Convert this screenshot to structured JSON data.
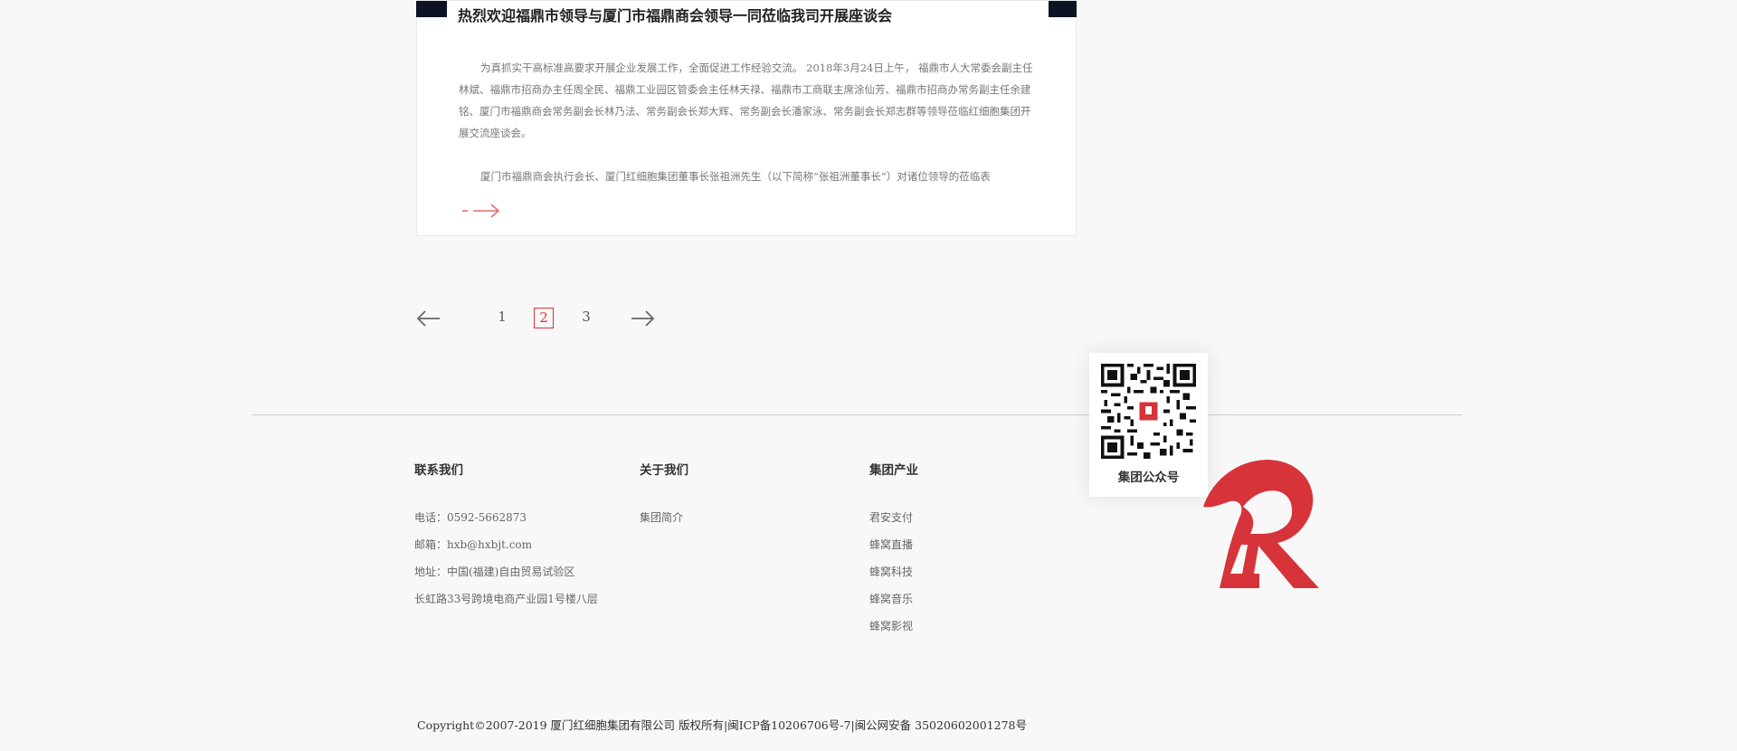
{
  "article": {
    "title": "热烈欢迎福鼎市领导与厦门市福鼎商会领导一同莅临我司开展座谈会",
    "paragraph1": "为真抓实干高标准高要求开展企业发展工作，全面促进工作经验交流。 2018年3月24日上午， 福鼎市人大常委会副主任林斌、福鼎市招商办主任周全民、福鼎工业园区管委会主任林天禄、福鼎市工商联主席涂仙芳、福鼎市招商办常务副主任余建铭、厦门市福鼎商会常务副会长林乃法、常务副会长郑大辉、常务副会长潘家泳、常务副会长郑志群等领导莅临红细胞集团开展交流座谈会。",
    "paragraph2": "厦门市福鼎商会执行会长、厦门红细胞集团董事长张祖洲先生（以下简称“张祖洲董事长”）对诸位领导的莅临表",
    "more_icon": "arrow-right-icon"
  },
  "pagination": {
    "prev_icon": "arrow-left-icon",
    "next_icon": "arrow-right-icon",
    "pages": [
      "1",
      "2",
      "3"
    ],
    "current": "2"
  },
  "footer": {
    "contact": {
      "title": "联系我们",
      "items": [
        "电话：0592-5662873",
        "邮箱：hxb@hxbjt.com",
        "地址：中国(福建)自由贸易试验区",
        "长虹路33号跨境电商产业园1号楼八层"
      ]
    },
    "about": {
      "title": "关于我们",
      "items": [
        "集团简介"
      ]
    },
    "industry": {
      "title": "集团产业",
      "items": [
        "君安支付",
        "蜂窝直播",
        "蜂窝科技",
        "蜂窝音乐",
        "蜂窝影视"
      ]
    },
    "qr_label": "集团公众号",
    "copyright": "Copyright©2007-2019 厦门红细胞集团有限公司 版权所有",
    "icp": "闽ICP备10206706号-7",
    "police": "闽公网安备 35020602001278号",
    "separator": "|",
    "accent_color": "#d7333a"
  }
}
